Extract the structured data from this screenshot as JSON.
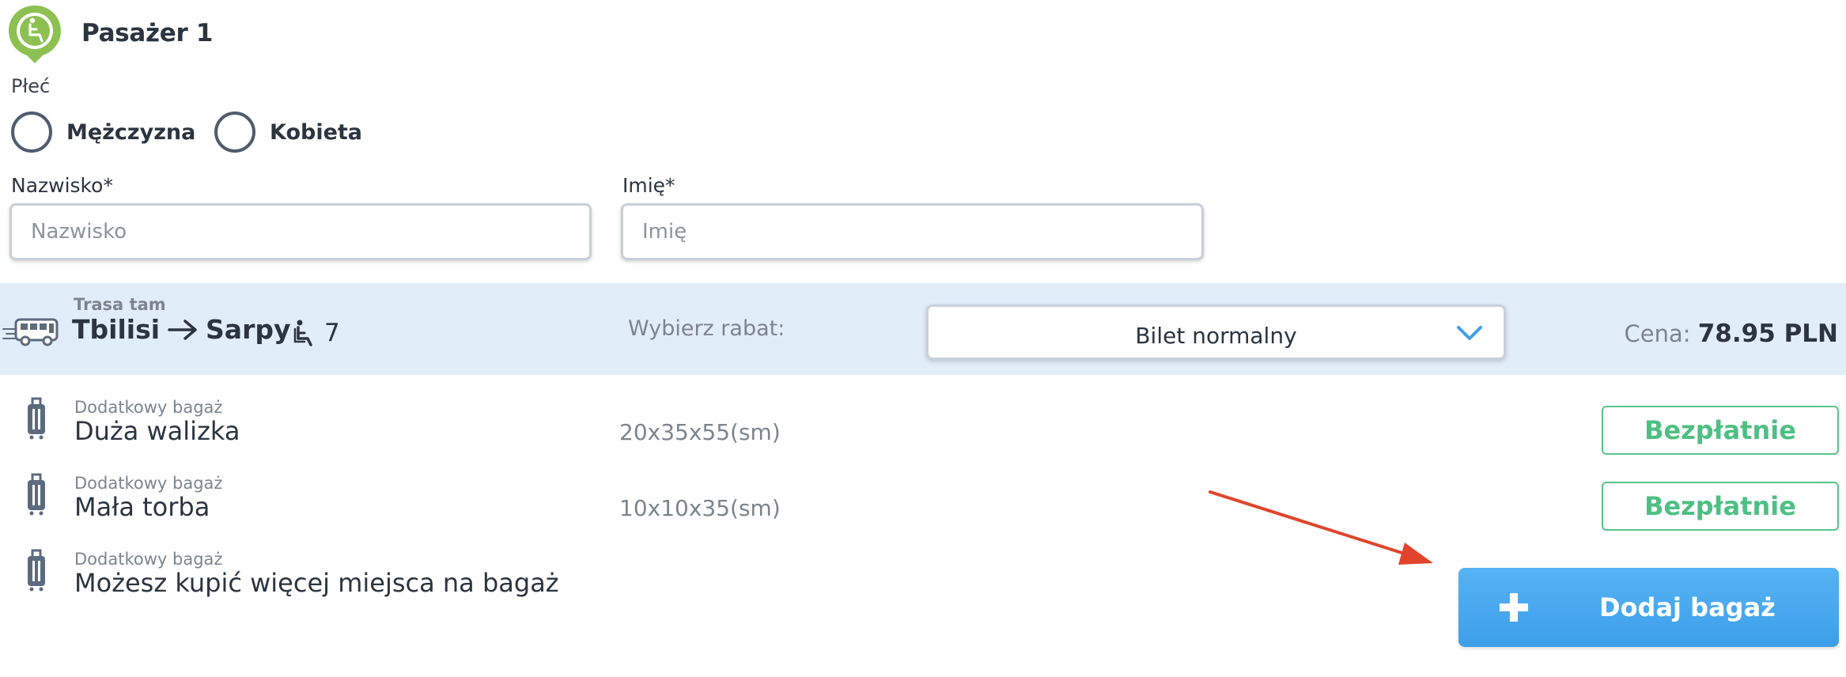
{
  "passenger": {
    "title": "Pasażer 1",
    "gender_label": "Płeć",
    "gender_options": [
      "Mężczyzna",
      "Kobieta"
    ],
    "last_name_label": "Nazwisko*",
    "last_name_placeholder": "Nazwisko",
    "last_name_value": "",
    "first_name_label": "Imię*",
    "first_name_placeholder": "Imię",
    "first_name_value": ""
  },
  "route": {
    "subtitle": "Trasa tam",
    "from": "Tbilisi",
    "to": "Sarpy",
    "seat": "7",
    "discount_label": "Wybierz rabat:",
    "discount_value": "Bilet normalny",
    "price_label": "Cena:",
    "price_value": "78.95 PLN"
  },
  "luggage": {
    "items": [
      {
        "subtitle": "Dodatkowy bagaż",
        "title": "Duża walizka",
        "size": "20x35x55(sm)",
        "button": "Bezpłatnie"
      },
      {
        "subtitle": "Dodatkowy bagaż",
        "title": "Mała torba",
        "size": "10x10x35(sm)",
        "button": "Bezpłatnie"
      },
      {
        "subtitle": "Dodatkowy bagaż",
        "title": "Możesz kupić więcej miejsca na bagaż"
      }
    ],
    "add_button": "Dodaj bagaż"
  },
  "colors": {
    "accent_green": "#8cc152",
    "free_green": "#4fbf84",
    "add_blue": "#3d9fea",
    "route_band": "#e2edfa",
    "annotation_arrow": "#e0452c"
  }
}
